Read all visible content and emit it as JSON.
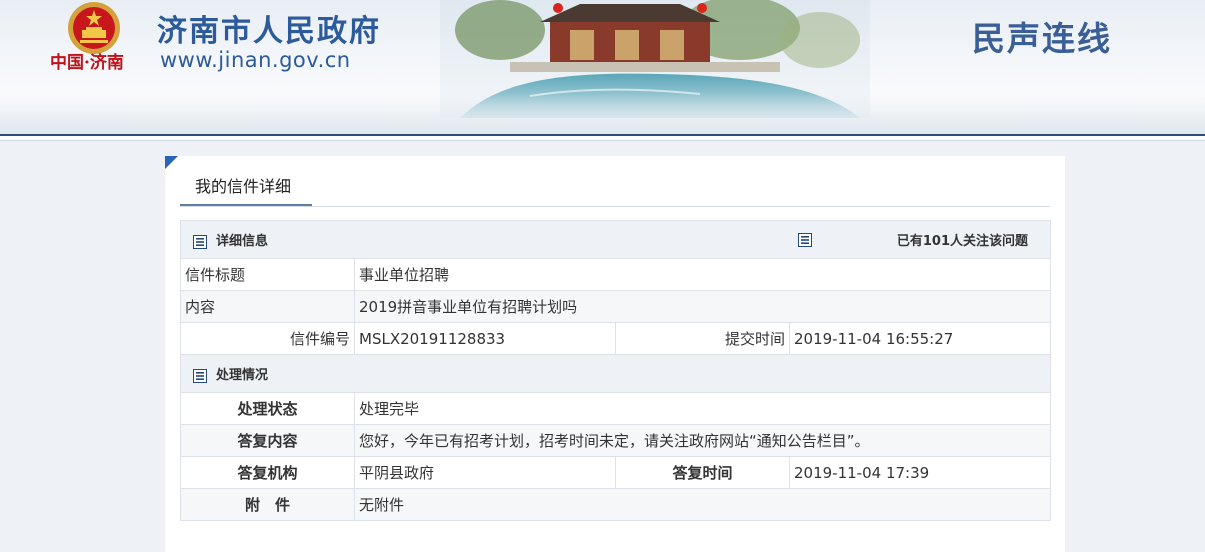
{
  "header": {
    "china_mark": "中国·济南",
    "site_name": "济南市人民政府",
    "site_url": "www.jinan.gov.cn",
    "section_title": "民声连线"
  },
  "page_tab": "我的信件详细",
  "details": {
    "heading": "详细信息",
    "followers_text": "已有101人关注该问题",
    "rows": {
      "title_label": "信件标题",
      "title_value": "事业单位招聘",
      "content_label": "内容",
      "content_value": "2019拼音事业单位有招聘计划吗",
      "number_label": "信件编号",
      "number_value": "MSLX20191128833",
      "submit_label": "提交时间",
      "submit_value": "2019-11-04 16:55:27"
    }
  },
  "handling": {
    "heading": "处理情况",
    "status_label": "处理状态",
    "status_value": "处理完毕",
    "reply_label": "答复内容",
    "reply_value": "您好，今年已有招考计划，招考时间未定，请关注政府网站“通知公告栏目”。",
    "org_label": "答复机构",
    "org_value": "平阴县政府",
    "reply_time_label": "答复时间",
    "reply_time_value": "2019-11-04 17:39",
    "attach_label": "附　件",
    "attach_value": "无附件"
  },
  "colors": {
    "brand_blue": "#2c5a9a",
    "emblem_red": "#c1121b",
    "accent_blue": "#2a64b5"
  },
  "icons": [
    "national-emblem-icon",
    "list-icon"
  ]
}
